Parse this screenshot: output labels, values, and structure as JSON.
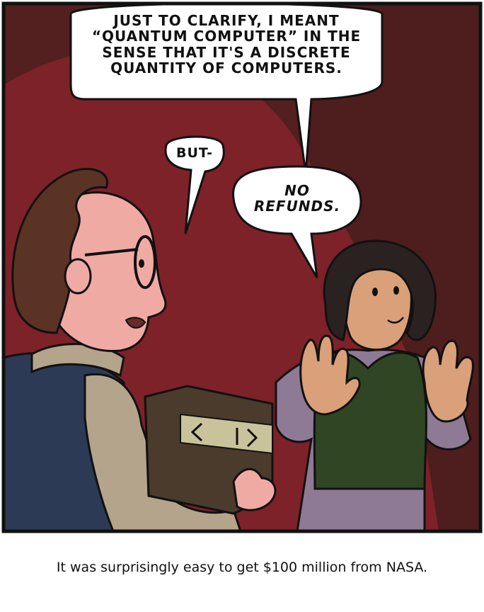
{
  "comic": {
    "bubbles": {
      "top_text": "JUST TO CLARIFY, I MEANT\n“QUANTUM COMPUTER” IN THE\nSENSE THAT IT'S A DISCRETE\nQUANTITY OF COMPUTERS.",
      "but_text": "BUT-",
      "refund_text": "NO\nREFUNDS."
    },
    "caption": "It was surprisingly easy to get $100 million from NASA.",
    "colors": {
      "background_dark": "#531f1f",
      "spotlight": "#7d2229",
      "outline": "#111111",
      "vest_navy": "#2c3a56",
      "box_brown": "#4a3b2c",
      "box_label": "#c8c39a",
      "sweater_green": "#2f4524",
      "shirt_lavender": "#8e7a95",
      "skin_light": "#f0aaa4",
      "skin_tan": "#d9a079",
      "hair_brown": "#5a3324",
      "hair_dark": "#2a2221"
    }
  }
}
